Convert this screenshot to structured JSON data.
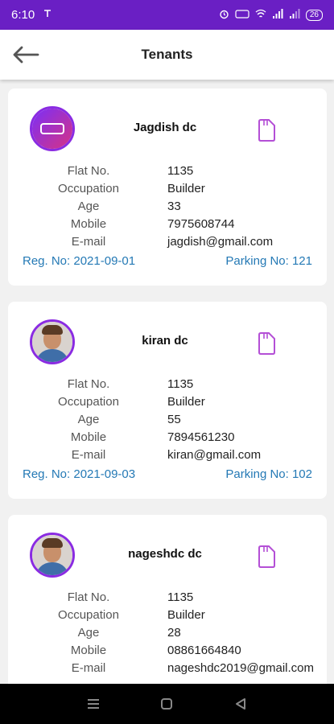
{
  "status_bar": {
    "time": "6:10",
    "battery": "26"
  },
  "app_bar": {
    "title": "Tenants"
  },
  "labels": {
    "flat": "Flat No.",
    "occupation": "Occupation",
    "age": "Age",
    "mobile": "Mobile",
    "email": "E-mail"
  },
  "tenants": [
    {
      "name": "Jagdish dc",
      "avatar": "app-logo-icon",
      "flat": "1135",
      "occupation": "Builder",
      "age": "33",
      "mobile": "7975608744",
      "email": "jagdish@gmail.com",
      "reg": "Reg. No: 2021-09-01",
      "parking": "Parking No: 121"
    },
    {
      "name": "kiran dc",
      "avatar": "person-photo",
      "flat": "1135",
      "occupation": "Builder",
      "age": "55",
      "mobile": "7894561230",
      "email": "kiran@gmail.com",
      "reg": "Reg. No: 2021-09-03",
      "parking": "Parking No: 102"
    },
    {
      "name": "nageshdc dc",
      "avatar": "person-photo",
      "flat": "1135",
      "occupation": "Builder",
      "age": "28",
      "mobile": "08861664840",
      "email": "nageshdc2019@gmail.com"
    }
  ],
  "colors": {
    "status_bar": "#6a1fc4",
    "accent": "#8a2be2",
    "link": "#2479b5"
  }
}
